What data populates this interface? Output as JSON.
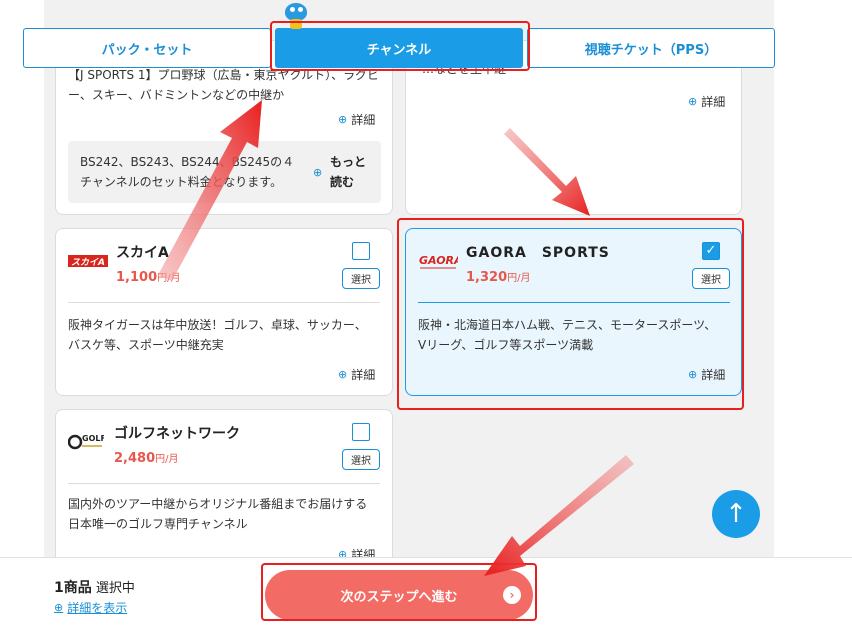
{
  "tabs": [
    {
      "label": "パック・セット"
    },
    {
      "label": "チャンネル"
    },
    {
      "label": "視聴チケット（PPS）"
    }
  ],
  "cards": {
    "top_left": {
      "desc_partial": "【J SPORTS 1】プロ野球（広島・東京ヤクルト）、ラグビー、スキー、バドミントンなどの中継か",
      "detail": "詳細",
      "info": "BS242、BS243、BS244、BS245の４チャンネルのセット料金となります。",
      "more": "もっと読む"
    },
    "top_right": {
      "desc_partial": "…などを生中継",
      "detail": "詳細"
    },
    "skya": {
      "logo": "スカイA",
      "name": "スカイA",
      "price": "1,100",
      "unit": "円/月",
      "select": "選択",
      "desc": "阪神タイガースは年中放送！ゴルフ、卓球、サッカー、バスケ等、スポーツ中継充実",
      "detail": "詳細"
    },
    "gaora": {
      "logo": "GAORA",
      "name": "GAORA　SPORTS",
      "price": "1,320",
      "unit": "円/月",
      "select": "選択",
      "check": "✓",
      "desc": "阪神・北海道日本ハム戦、テニス、モータースポーツ、Vリーグ、ゴルフ等スポーツ満載",
      "detail": "詳細"
    },
    "golf": {
      "logo": "GOLF",
      "name": "ゴルフネットワーク",
      "price": "2,480",
      "unit": "円/月",
      "select": "選択",
      "desc": "国内外のツアー中継からオリジナル番組までお届けする日本唯一のゴルフ専門チャンネル",
      "detail": "詳細"
    }
  },
  "bottom": {
    "count_num": "1商品",
    "count_label": "選択中",
    "show_detail": "詳細を表示",
    "next": "次のステップへ進む"
  },
  "colors": {
    "accent": "#1a9de6",
    "price": "#e8574c",
    "next": "#f26b64",
    "annotation": "#e81f1f"
  },
  "icons": [
    "zoom-icon",
    "arrow-up-icon",
    "chevron-right-icon",
    "checkmark-icon"
  ]
}
